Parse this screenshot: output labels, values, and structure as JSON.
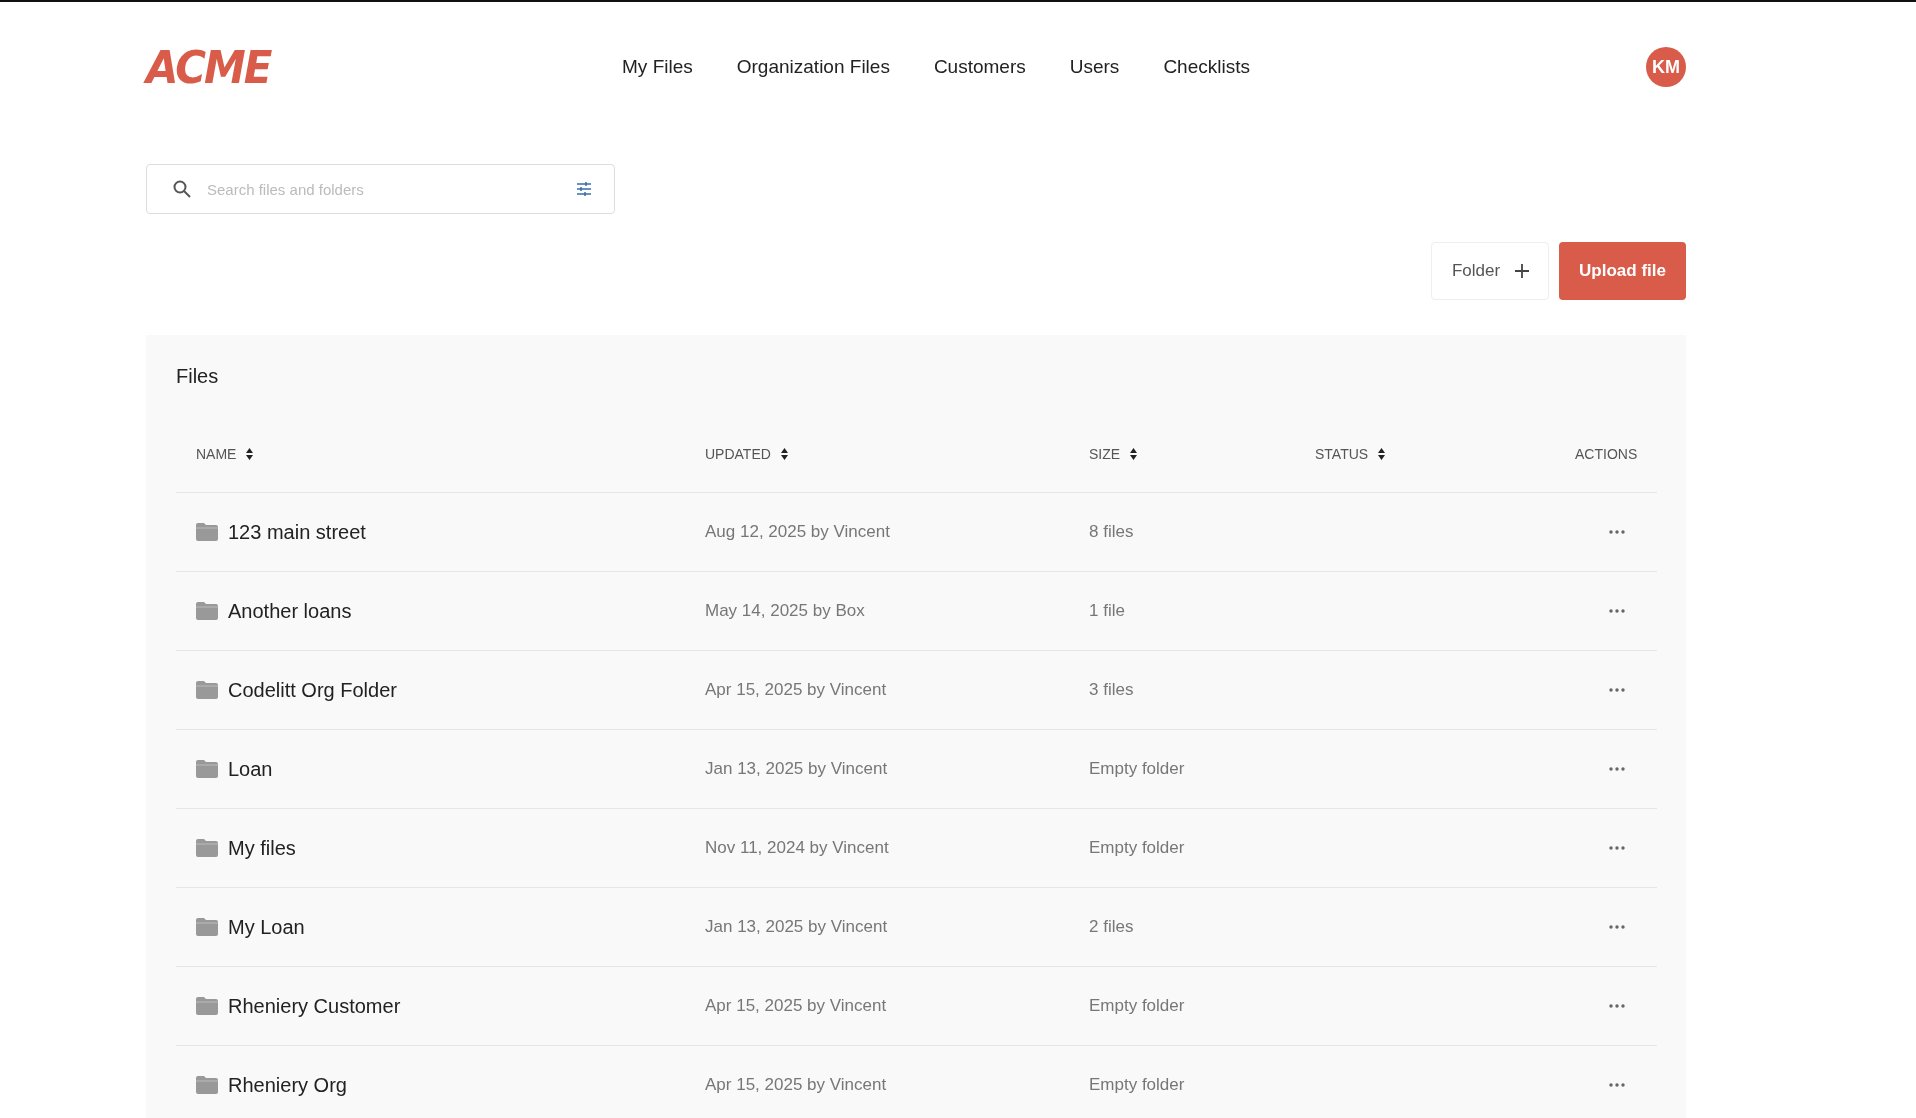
{
  "header": {
    "logo": "ACME",
    "nav": [
      {
        "label": "My Files"
      },
      {
        "label": "Organization Files"
      },
      {
        "label": "Customers"
      },
      {
        "label": "Users"
      },
      {
        "label": "Checklists"
      }
    ],
    "avatar": "KM"
  },
  "search": {
    "placeholder": "Search files and folders"
  },
  "buttons": {
    "folder": "Folder",
    "upload": "Upload file"
  },
  "files": {
    "title": "Files",
    "columns": [
      {
        "label": "NAME",
        "sortable": true
      },
      {
        "label": "UPDATED",
        "sortable": true
      },
      {
        "label": "SIZE",
        "sortable": true
      },
      {
        "label": "STATUS",
        "sortable": true
      },
      {
        "label": "ACTIONS",
        "sortable": false
      }
    ],
    "rows": [
      {
        "name": "123 main street",
        "updated": "Aug 12, 2025 by Vincent",
        "size": "8 files"
      },
      {
        "name": "Another loans",
        "updated": "May 14, 2025 by Box",
        "size": "1 file"
      },
      {
        "name": "Codelitt Org Folder",
        "updated": "Apr 15, 2025 by Vincent",
        "size": "3 files"
      },
      {
        "name": "Loan",
        "updated": "Jan 13, 2025 by Vincent",
        "size": "Empty folder"
      },
      {
        "name": "My files",
        "updated": "Nov 11, 2024 by Vincent",
        "size": "Empty folder"
      },
      {
        "name": "My Loan",
        "updated": "Jan 13, 2025 by Vincent",
        "size": "2 files"
      },
      {
        "name": "Rheniery Customer",
        "updated": "Apr 15, 2025 by Vincent",
        "size": "Empty folder"
      },
      {
        "name": "Rheniery Org",
        "updated": "Apr 15, 2025 by Vincent",
        "size": "Empty folder"
      }
    ]
  }
}
